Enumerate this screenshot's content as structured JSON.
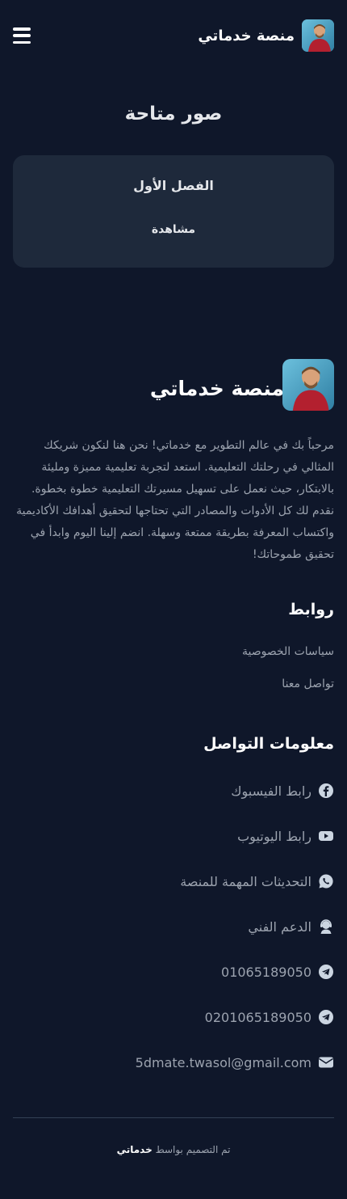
{
  "header": {
    "brand": "منصة خدماتي",
    "menu_icon": "hamburger-menu-icon"
  },
  "content": {
    "section_title": "صور متاحة",
    "card": {
      "title": "الفصل الأول",
      "action": "مشاهدة"
    }
  },
  "footer": {
    "brand": "منصة خدماتي",
    "about": "مرحباً بك في عالم التطوير مع خدماتي! نحن هنا لنكون شريكك المثالي في رحلتك التعليمية. استعد لتجربة تعليمية مميزة ومليئة بالابتكار، حيث نعمل على تسهيل مسيرتك التعليمية خطوة بخطوة. نقدم لك كل الأدوات والمصادر التي تحتاجها لتحقيق أهدافك الأكاديمية واكتساب المعرفة بطريقة ممتعة وسهلة. انضم إلينا اليوم وابدأ في تحقيق طموحاتك!",
    "links_title": "روابط",
    "links": [
      "سياسات الخصوصية",
      "تواصل معنا"
    ],
    "contact_title": "معلومات التواصل",
    "contacts": [
      {
        "label": "رابط الفيسبوك",
        "icon": "facebook-icon"
      },
      {
        "label": "رابط اليوتيوب",
        "icon": "youtube-icon"
      },
      {
        "label": "التحديثات المهمة للمنصة",
        "icon": "whatsapp-icon"
      },
      {
        "label": "الدعم الفني",
        "icon": "support-agent-icon"
      },
      {
        "label": "01065189050",
        "icon": "telegram-icon"
      },
      {
        "label": "0201065189050",
        "icon": "telegram-icon"
      },
      {
        "label": "5dmate.twasol@gmail.com",
        "icon": "envelope-icon"
      }
    ],
    "credit_prefix": "تم التصميم بواسط",
    "credit_brand": "خدماتي"
  },
  "colors": {
    "background": "#0f172a",
    "card": "#1e293b",
    "text_muted": "#9ca3af",
    "icon": "#cbd5e1"
  }
}
